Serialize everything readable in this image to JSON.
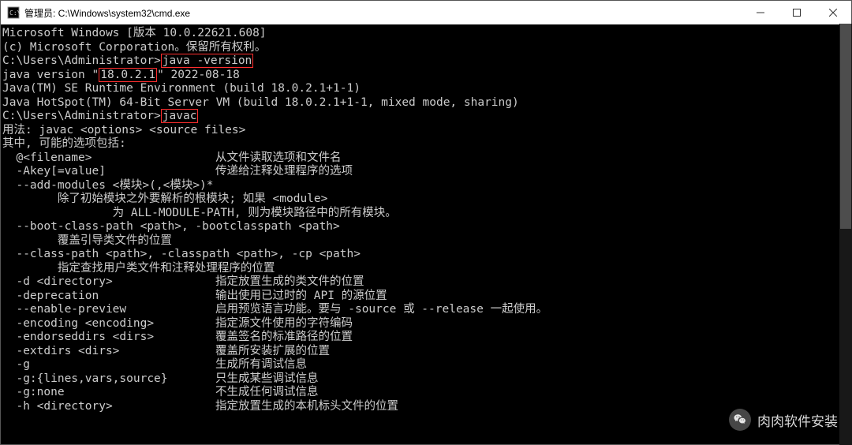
{
  "titlebar": {
    "title": "管理员: C:\\Windows\\system32\\cmd.exe"
  },
  "term": {
    "l1": "Microsoft Windows [版本 10.0.22621.608]",
    "l2": "(c) Microsoft Corporation。保留所有权利。",
    "blank": "",
    "prompt1a": "C:\\Users\\Administrator>",
    "cmd1": "java -version",
    "jv1a": "java version \"",
    "jv_version": "18.0.2.1",
    "jv1b": "\" 2022-08-18",
    "jv2": "Java(TM) SE Runtime Environment (build 18.0.2.1+1-1)",
    "jv3": "Java HotSpot(TM) 64-Bit Server VM (build 18.0.2.1+1-1, mixed mode, sharing)",
    "prompt2a": "C:\\Users\\Administrator>",
    "cmd2": "javac",
    "u1": "用法: javac <options> <source files>",
    "u2": "其中, 可能的选项包括:",
    "o1a": "  @<filename>",
    "o1b": "从文件读取选项和文件名",
    "o2a": "  -Akey[=value]",
    "o2b": "传递给注释处理程序的选项",
    "o3": "  --add-modules <模块>(,<模块>)*",
    "o3d1": "        除了初始模块之外要解析的根模块; 如果 <module>",
    "o3d2": "                为 ALL-MODULE-PATH, 则为模块路径中的所有模块。",
    "o4": "  --boot-class-path <path>, -bootclasspath <path>",
    "o4d": "        覆盖引导类文件的位置",
    "o5": "  --class-path <path>, -classpath <path>, -cp <path>",
    "o5d": "        指定查找用户类文件和注释处理程序的位置",
    "o6a": "  -d <directory>",
    "o6b": "指定放置生成的类文件的位置",
    "o7a": "  -deprecation",
    "o7b": "输出使用已过时的 API 的源位置",
    "o8a": "  --enable-preview",
    "o8b": "启用预览语言功能。要与 -source 或 --release 一起使用。",
    "o9a": "  -encoding <encoding>",
    "o9b": "指定源文件使用的字符编码",
    "o10a": "  -endorseddirs <dirs>",
    "o10b": "覆盖签名的标准路径的位置",
    "o11a": "  -extdirs <dirs>",
    "o11b": "覆盖所安装扩展的位置",
    "o12a": "  -g",
    "o12b": "生成所有调试信息",
    "o13a": "  -g:{lines,vars,source}",
    "o13b": "只生成某些调试信息",
    "o14a": "  -g:none",
    "o14b": "不生成任何调试信息",
    "o15a": "  -h <directory>",
    "o15b": "指定放置生成的本机标头文件的位置"
  },
  "watermark": {
    "text": "肉肉软件安装"
  }
}
